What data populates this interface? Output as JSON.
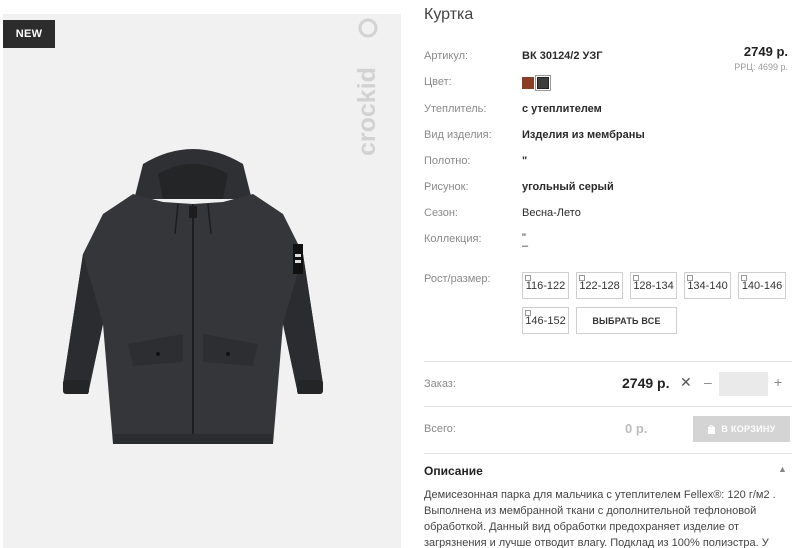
{
  "badge": "NEW",
  "watermark": "crockid",
  "product": {
    "title": "Куртка",
    "price": "2749 р.",
    "rrp": "РРЦ: 4699 р."
  },
  "attributes": {
    "article": {
      "label": "Артикул:",
      "value": "ВК 30124/2 УЗГ"
    },
    "color": {
      "label": "Цвет:"
    },
    "insulation": {
      "label": "Утеплитель:",
      "value": "с утеплителем"
    },
    "type": {
      "label": "Вид изделия:",
      "value": "Изделия из мембраны"
    },
    "fabric": {
      "label": "Полотно:",
      "value": "\""
    },
    "pattern": {
      "label": "Рисунок:",
      "value": "угольный серый"
    },
    "season": {
      "label": "Сезон:",
      "value": "Весна-Лето"
    },
    "collection": {
      "label": "Коллекция:",
      "value1": "\"",
      "value2": "–"
    }
  },
  "colors": [
    "#8b3d26",
    "#3d3d3d"
  ],
  "sizes": {
    "label": "Рост/размер:",
    "items": [
      "116-122",
      "122-128",
      "128-134",
      "134-140",
      "140-146",
      "146-152"
    ],
    "select_all": "ВЫБРАТЬ ВСЕ"
  },
  "order": {
    "label": "Заказ:",
    "price": "2749 р.",
    "multiply": "✕",
    "minus": "–",
    "plus": "+",
    "qty": ""
  },
  "total": {
    "label": "Всего:",
    "value": "0 р.",
    "cart_button": "В КОРЗИНУ"
  },
  "description": {
    "title": "Описание",
    "text": "Демисезонная парка для мальчика с утеплителем Fellex®: 120 г/м2 . Выполнена из мембранной ткани с дополнительной тефлоновой обработкой. Данный вид обработки предохраняет изделие от загрязнения и лучше отводит влагу. Подклад из 100% полиэстра. У"
  }
}
